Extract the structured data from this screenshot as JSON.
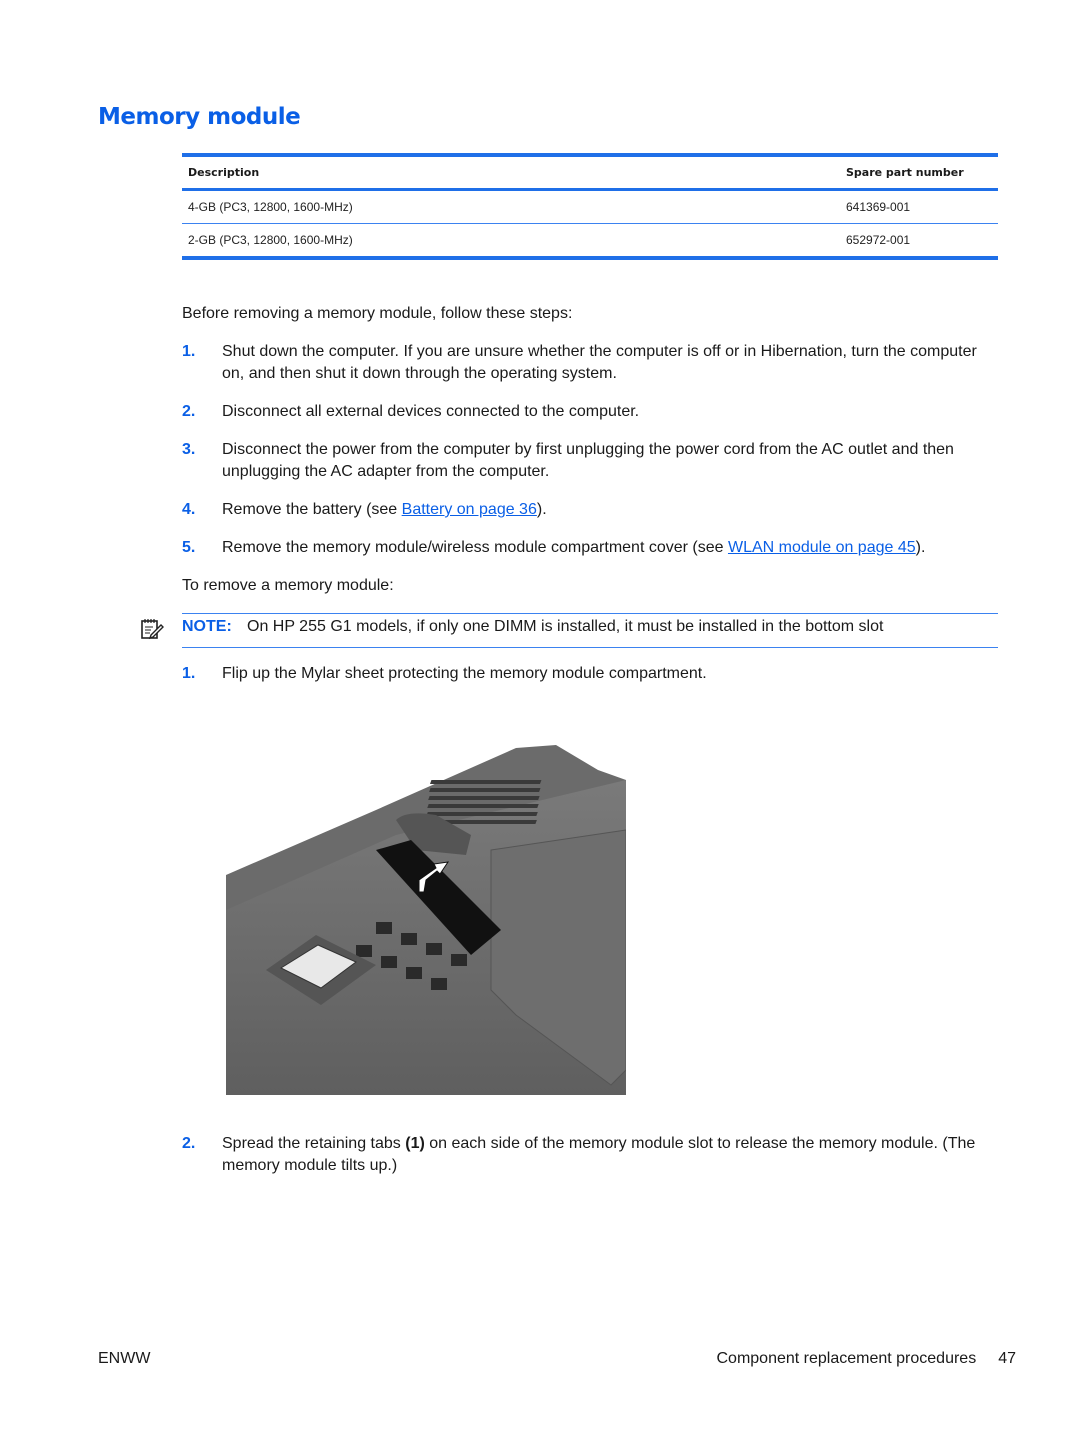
{
  "title": "Memory module",
  "table": {
    "headers": [
      "Description",
      "Spare part number"
    ],
    "rows": [
      {
        "description": "4-GB (PC3, 12800, 1600-MHz)",
        "part": "641369-001"
      },
      {
        "description": "2-GB (PC3, 12800, 1600-MHz)",
        "part": "652972-001"
      }
    ]
  },
  "intro": "Before removing a memory module, follow these steps:",
  "prep_steps": [
    {
      "num": "1.",
      "text": "Shut down the computer. If you are unsure whether the computer is off or in Hibernation, turn the computer on, and then shut it down through the operating system."
    },
    {
      "num": "2.",
      "text": "Disconnect all external devices connected to the computer."
    },
    {
      "num": "3.",
      "text": "Disconnect the power from the computer by first unplugging the power cord from the AC outlet and then unplugging the AC adapter from the computer."
    },
    {
      "num": "4.",
      "text_before": "Remove the battery (see ",
      "link": "Battery on page 36",
      "text_after": ")."
    },
    {
      "num": "5.",
      "text_before": "Remove the memory module/wireless module compartment cover (see ",
      "link": "WLAN module on page 45",
      "text_after": ")."
    }
  ],
  "remove_intro": "To remove a memory module:",
  "note": {
    "icon": "note-pencil-icon",
    "label": "NOTE:",
    "text": "On HP 255 G1 models, if only one DIMM is installed, it must be installed in the bottom slot"
  },
  "remove_steps": [
    {
      "num": "1.",
      "text": "Flip up the Mylar sheet protecting the memory module compartment."
    },
    {
      "num": "2.",
      "text_before": "Spread the retaining tabs ",
      "bold": "(1)",
      "text_after": " on each side of the memory module slot to release the memory module. (The memory module tilts up.)"
    }
  ],
  "illustration": {
    "alt": "Laptop bottom with Mylar sheet being flipped up over memory module compartment"
  },
  "footer": {
    "left": "ENWW",
    "section": "Component replacement procedures",
    "page": "47"
  },
  "colors": {
    "accent": "#0a5fe6",
    "rule": "#1f6fe8"
  }
}
